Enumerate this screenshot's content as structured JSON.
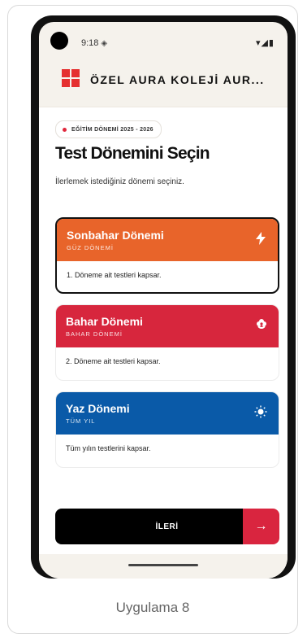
{
  "status": {
    "time": "9:18",
    "time_icon": "◈",
    "right_icons": "▾◢▮"
  },
  "appbar": {
    "title": "ÖZEL AURA KOLEJİ AUR..."
  },
  "badge": {
    "label": "EĞİTİM DÖNEMİ 2025 - 2026"
  },
  "page": {
    "title": "Test Dönemini Seçin",
    "subtitle": "İlerlemek istediğiniz dönemi seçiniz."
  },
  "terms": [
    {
      "name": "Sonbahar Dönemi",
      "sub": "GÜZ DÖNEMİ",
      "desc": "1. Döneme ait testleri kapsar.",
      "icon": "bolt-icon",
      "color": "#e8642a",
      "selected": true
    },
    {
      "name": "Bahar Dönemi",
      "sub": "BAHAR DÖNEMİ",
      "desc": "2. Döneme ait testleri kapsar.",
      "icon": "flower-icon",
      "color": "#d7263d",
      "selected": false
    },
    {
      "name": "Yaz Dönemi",
      "sub": "TÜM YIL",
      "desc": "Tüm yılın testlerini kapsar.",
      "icon": "sun-icon",
      "color": "#0a5aa8",
      "selected": false
    }
  ],
  "next": {
    "label": "İLERİ",
    "arrow": "→"
  },
  "caption": "Uygulama 8",
  "colors": {
    "accent": "#d9253f",
    "logo": "#e53030"
  }
}
